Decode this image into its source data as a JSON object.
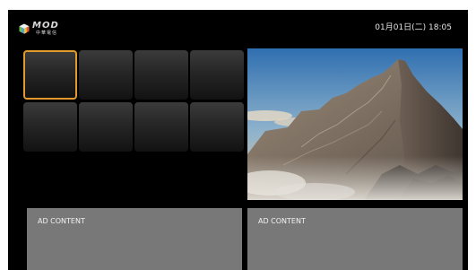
{
  "header": {
    "logo": {
      "brand": "MOD",
      "subtitle": "中華電信"
    },
    "datetime": "01月01日(二) 18:05"
  },
  "tiles": [
    {
      "selected": true
    },
    {
      "selected": false
    },
    {
      "selected": false
    },
    {
      "selected": false
    },
    {
      "selected": false
    },
    {
      "selected": false
    },
    {
      "selected": false
    },
    {
      "selected": false
    }
  ],
  "ads": [
    {
      "label": "AD CONTENT"
    },
    {
      "label": "AD CONTENT"
    }
  ],
  "colors": {
    "background": "#000000",
    "focus_border": "#e39a2c",
    "ad_panel": "#787878",
    "text": "#e6e6e6"
  }
}
